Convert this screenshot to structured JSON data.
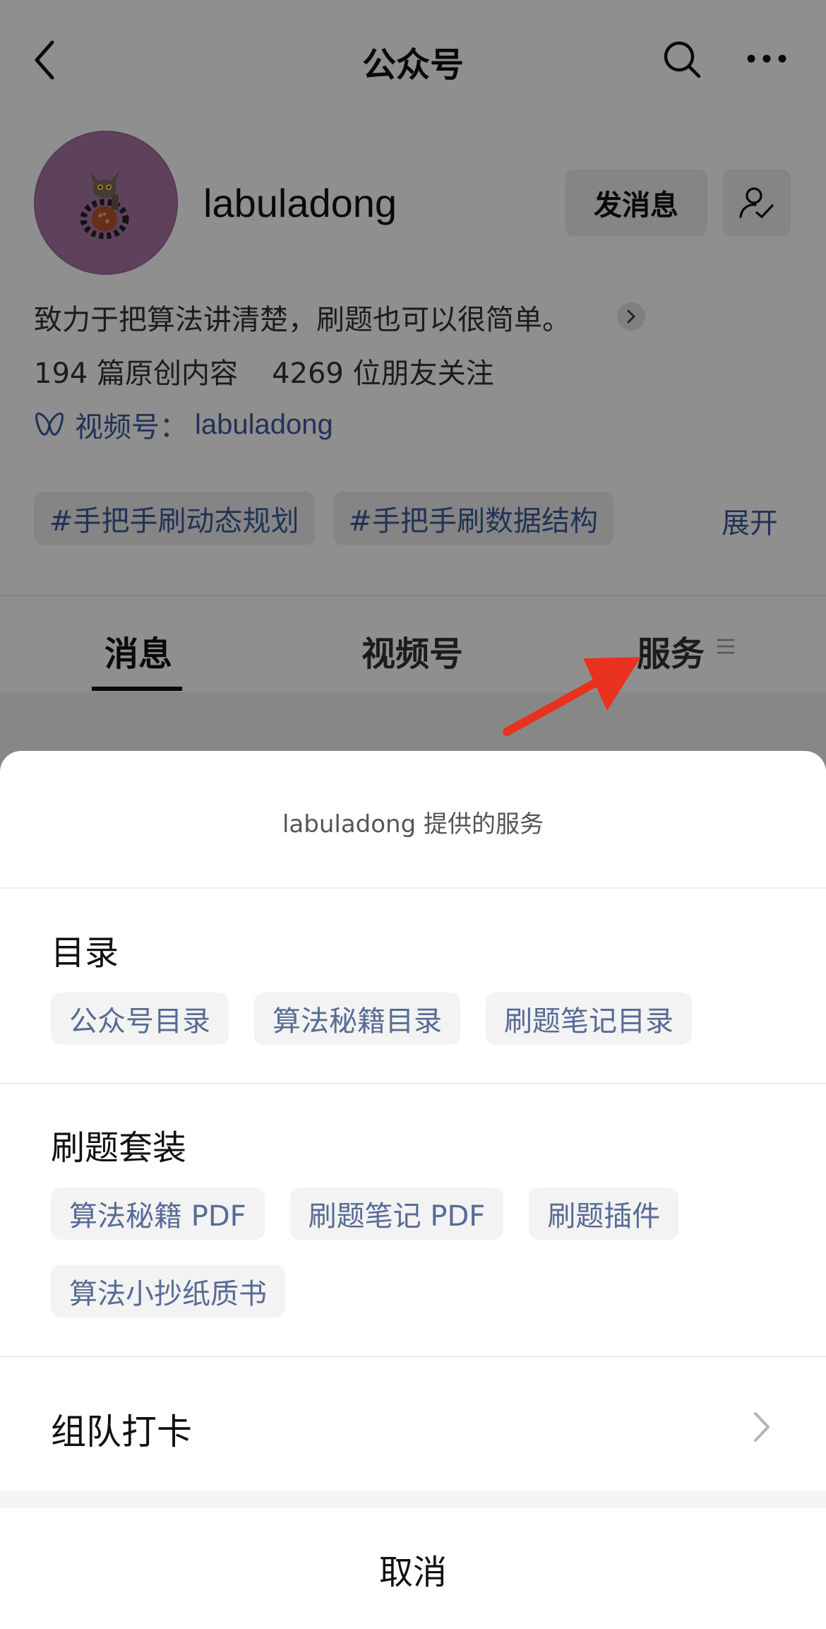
{
  "nav": {
    "title": "公众号"
  },
  "profile": {
    "name": "labuladong",
    "message_button": "发消息",
    "description": "致力于把算法讲清楚，刷题也可以很简单。",
    "original_count": "194 篇原创内容",
    "followers": "4269 位朋友关注",
    "channels_label": "视频号：",
    "channels_name": "labuladong"
  },
  "tags": {
    "items": [
      "#手把手刷动态规划",
      "#手把手刷数据结构"
    ],
    "expand_label": "展开"
  },
  "tabs": {
    "items": [
      {
        "label": "消息",
        "active": true
      },
      {
        "label": "视频号",
        "active": false
      },
      {
        "label": "服务",
        "active": false
      }
    ]
  },
  "colors": {
    "link": "#576b95",
    "arrow": "#e8321e",
    "overlay": "rgba(0,0,0,0.44)"
  },
  "sheet": {
    "title": "labuladong 提供的服务",
    "sections": [
      {
        "title": "目录",
        "chips": [
          "公众号目录",
          "算法秘籍目录",
          "刷题笔记目录"
        ]
      },
      {
        "title": "刷题套装",
        "chips": [
          "算法秘籍 PDF",
          "刷题笔记 PDF",
          "刷题插件",
          "算法小抄纸质书"
        ]
      }
    ],
    "link_row": "组队打卡",
    "cancel": "取消"
  }
}
